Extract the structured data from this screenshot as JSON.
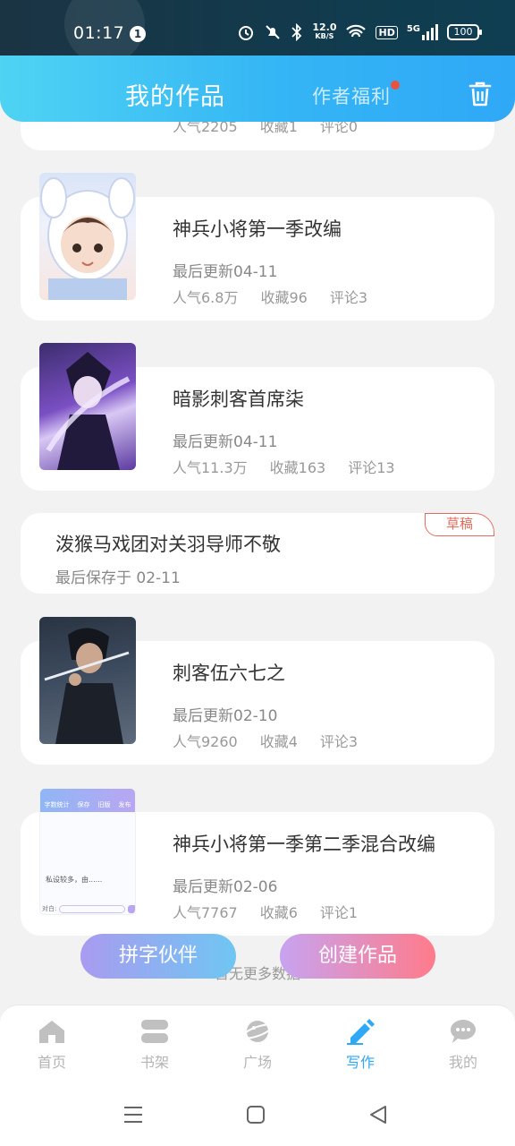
{
  "status_bar": {
    "time": "01:17",
    "notification_count": "1",
    "net_speed_value": "12.0",
    "net_speed_unit": "KB/S",
    "hd_label": "HD",
    "network": "5G",
    "battery": "100"
  },
  "header": {
    "title": "我的作品",
    "tab_welfare": "作者福利",
    "accent": "#34b5f5"
  },
  "works": [
    {
      "title": "",
      "updated": "",
      "stats": [
        "人气2205",
        "收藏1",
        "评论0"
      ]
    },
    {
      "title": "神兵小将第一季改编",
      "updated": "最后更新04-11",
      "stats": [
        "人气6.8万",
        "收藏96",
        "评论3"
      ]
    },
    {
      "title": "暗影刺客首席柒",
      "updated": "最后更新04-11",
      "stats": [
        "人气11.3万",
        "收藏163",
        "评论13"
      ]
    },
    {
      "title": "泼猴马戏团对关羽导师不敬",
      "saved": "最后保存于 02-11",
      "tag": "草稿"
    },
    {
      "title": "刺客伍六七之",
      "updated": "最后更新02-10",
      "stats": [
        "人气9260",
        "收藏4",
        "评论3"
      ]
    },
    {
      "title": "神兵小将第一季第二季混合改编",
      "updated": "最后更新02-06",
      "stats": [
        "人气7767",
        "收藏6",
        "评论1"
      ],
      "cover_texts": [
        "字数统计",
        "保存",
        "旧版",
        "发布",
        "私设较多，由......",
        "对白:"
      ]
    }
  ],
  "buttons": {
    "partner": "拼字伙伴",
    "create": "创建作品",
    "no_more": "暂无更多数据"
  },
  "tabbar": {
    "items": [
      "首页",
      "书架",
      "广场",
      "写作",
      "我的"
    ],
    "active_index": 3,
    "active_color": "#2fa8f6"
  }
}
